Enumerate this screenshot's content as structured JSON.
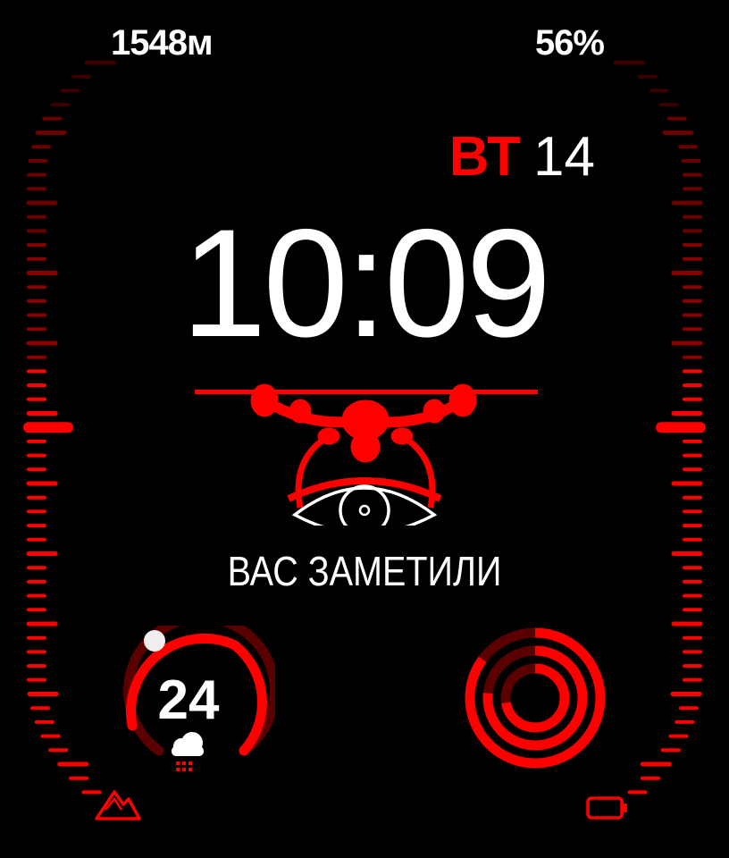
{
  "complications": {
    "altitude": "1548м",
    "battery": "56%",
    "weather_temp": "24"
  },
  "date": {
    "day": "ВТ",
    "number": "14"
  },
  "time": "10:09",
  "drone": {
    "caption": "ВАС ЗАМЕТИЛИ"
  },
  "icons": {
    "altitude": "mountain-icon",
    "weather": "rain-cloud-icon",
    "battery": "battery-icon",
    "drone": "drone-icon",
    "eye": "eye-icon"
  },
  "colors": {
    "accent": "#ff0000",
    "dark_accent": "#5a0000",
    "text": "#ffffff",
    "background": "#000000"
  }
}
